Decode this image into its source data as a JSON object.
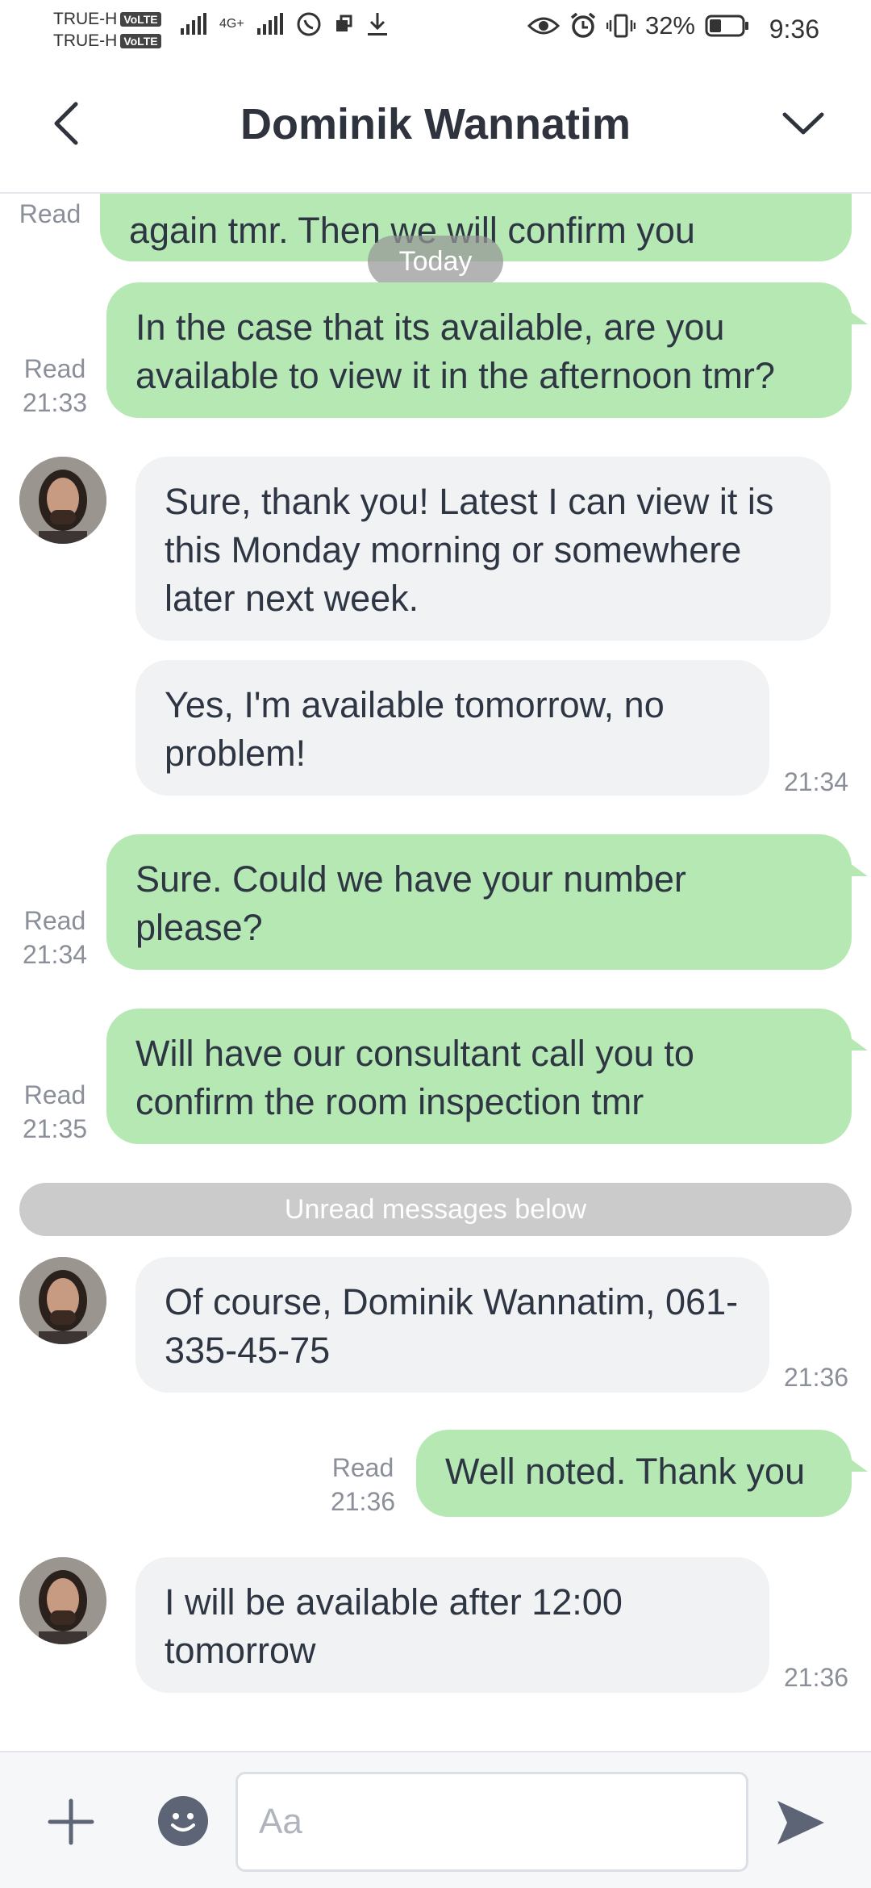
{
  "status_bar": {
    "carrier1": "TRUE-H",
    "carrier2": "TRUE-H",
    "volte": "VoLTE",
    "network": "4G+",
    "battery": "32%",
    "time": "9:36"
  },
  "header": {
    "title": "Dominik Wannatim"
  },
  "chat": {
    "today_label": "Today",
    "unread_label": "Unread messages below",
    "messages": [
      {
        "from": "me",
        "text": "again tmr. Then we will confirm you",
        "status": "Read",
        "time": ""
      },
      {
        "from": "me",
        "text": "In the case that its available, are you available to view it in the afternoon tmr?",
        "status": "Read",
        "time": "21:33"
      },
      {
        "from": "them",
        "text": "Sure, thank you! Latest I can view it is this Monday morning or somewhere later next week.",
        "time": ""
      },
      {
        "from": "them",
        "text": "Yes, I'm available tomorrow, no problem!",
        "time": "21:34"
      },
      {
        "from": "me",
        "text": "Sure. Could we have your number please?",
        "status": "Read",
        "time": "21:34"
      },
      {
        "from": "me",
        "text": "Will have our consultant call you to confirm the room inspection tmr",
        "status": "Read",
        "time": "21:35"
      },
      {
        "from": "them",
        "text": "Of course, Dominik Wannatim, 061-335-45-75",
        "time": "21:36"
      },
      {
        "from": "me",
        "text": "Well noted. Thank you",
        "status": "Read",
        "time": "21:36"
      },
      {
        "from": "them",
        "text": "I will be available after 12:00 tomorrow",
        "time": "21:36"
      }
    ]
  },
  "input": {
    "placeholder": "Aa"
  },
  "colors": {
    "my_bubble": "#b6e8b4",
    "their_bubble": "#f1f2f4",
    "meta_text": "#8a8f99",
    "icon": "#5d6475"
  }
}
